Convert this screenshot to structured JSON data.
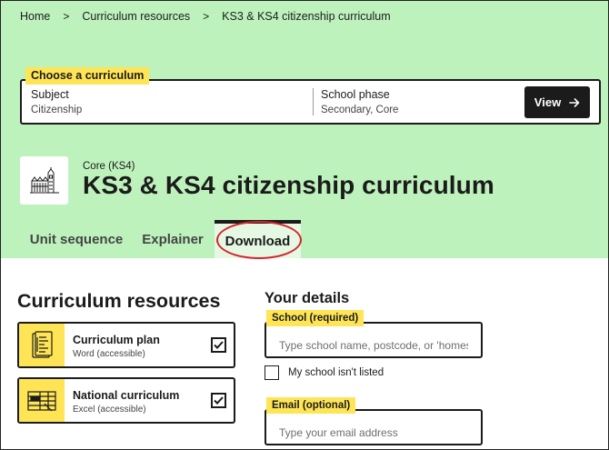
{
  "breadcrumb": [
    {
      "label": "Home"
    },
    {
      "label": "Curriculum resources"
    },
    {
      "label": "KS3 & KS4 citizenship curriculum"
    }
  ],
  "breadcrumb_separator": ">",
  "chooser": {
    "tag": "Choose a curriculum",
    "subject_label": "Subject",
    "subject_value": "Citizenship",
    "phase_label": "School phase",
    "phase_value": "Secondary, Core",
    "view_label": "View",
    "view_icon": "arrow-right-icon"
  },
  "header": {
    "subtitle": "Core (KS4)",
    "title": "KS3 & KS4 citizenship curriculum",
    "icon": "parliament-building-icon"
  },
  "tabs": [
    {
      "label": "Unit sequence",
      "active": false
    },
    {
      "label": "Explainer",
      "active": false
    },
    {
      "label": "Download",
      "active": true
    }
  ],
  "resources": {
    "heading": "Curriculum resources",
    "items": [
      {
        "title": "Curriculum plan",
        "subtitle": "Word (accessible)",
        "checked": true,
        "icon": "document-icon"
      },
      {
        "title": "National curriculum",
        "subtitle": "Excel (accessible)",
        "checked": true,
        "icon": "spreadsheet-icon"
      }
    ]
  },
  "details": {
    "heading": "Your details",
    "school_label": "School (required)",
    "school_placeholder": "Type school name, postcode, or 'homeschool'",
    "not_listed_label": "My school isn't listed",
    "email_label": "Email (optional)",
    "email_placeholder": "Type your email address"
  },
  "colors": {
    "hero_background": "#bef2bd",
    "active_tab": "#e4f8e4",
    "highlight_tag": "#ffe555",
    "annotation_ring": "#d6232b",
    "dark": "#1b1b1b"
  }
}
